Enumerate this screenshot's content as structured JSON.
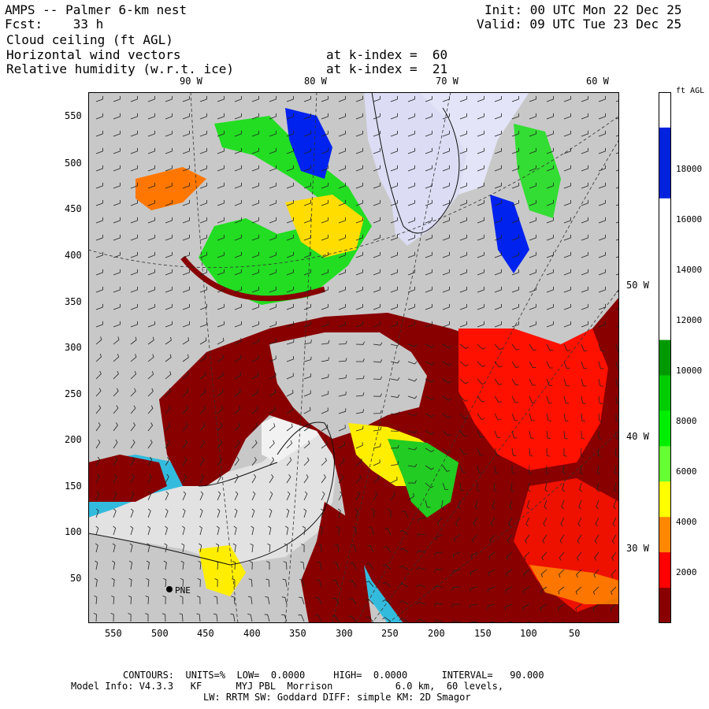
{
  "header": {
    "line1_left": "AMPS -- Palmer 6-km nest",
    "line2_left": "Fcst:    33 h",
    "line1_right": "Init: 00 UTC Mon 22 Dec 25",
    "line2_right": "Valid: 09 UTC Tue 23 Dec 25",
    "field1": "Cloud ceiling (ft AGL)",
    "field2": "Horizontal wind vectors",
    "field3": "Relative humidity (w.r.t. ice)",
    "kindex2": "at k-index =  60",
    "kindex3": "at k-index =  21"
  },
  "axes": {
    "y_ticks": [
      "550",
      "500",
      "450",
      "400",
      "350",
      "300",
      "250",
      "200",
      "150",
      "100",
      "50"
    ],
    "x_ticks": [
      "550",
      "500",
      "450",
      "400",
      "350",
      "300",
      "250",
      "200",
      "150",
      "100",
      "50"
    ],
    "top_lon": [
      "90 W",
      "80 W",
      "70 W",
      "60 W"
    ],
    "right_lon": [
      "50 W",
      "40 W",
      "30 W"
    ]
  },
  "colorbar": {
    "unit": "ft AGL",
    "labels": [
      "18000",
      "16000",
      "14000",
      "12000",
      "10000",
      "8000",
      "6000",
      "4000",
      "2000"
    ],
    "colors": [
      "#ffffff",
      "#0022dd",
      "#0022dd",
      "#ffffff",
      "#ffffff",
      "#ffffff",
      "#ffffff",
      "#009900",
      "#00cc00",
      "#00ee00",
      "#66ff33",
      "#ffff00",
      "#ff8800",
      "#ff0000",
      "#880000"
    ]
  },
  "station": "PNE",
  "footer": {
    "line1": "CONTOURS:  UNITS=%  LOW=  0.0000     HIGH=  0.0000      INTERVAL=   90.000",
    "line2": "Model Info: V4.3.3   KF      MYJ PBL  Morrison           6.0 km,  60 levels,",
    "line3": "LW: RRTM SW: Goddard DIFF: simple KM: 2D Smagor"
  }
}
